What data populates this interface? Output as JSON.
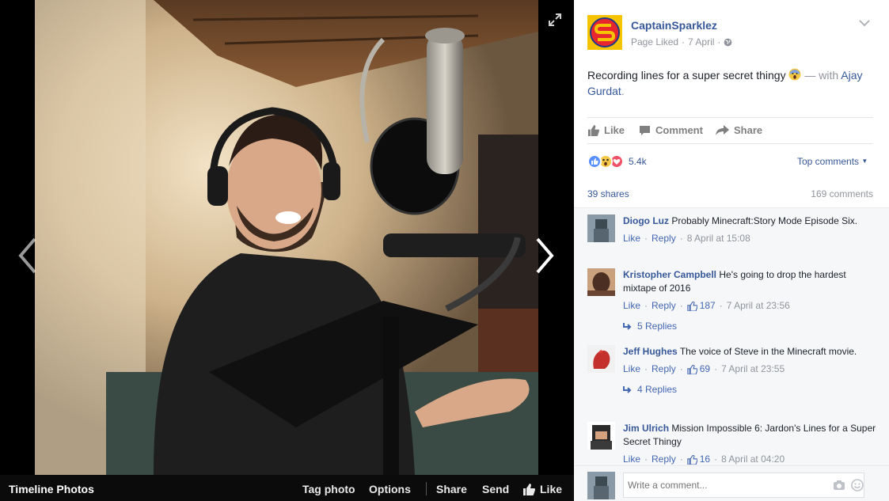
{
  "photo_viewer": {
    "album_title": "Timeline Photos",
    "actions": {
      "tag": "Tag photo",
      "options": "Options",
      "share": "Share",
      "send": "Send",
      "like": "Like"
    }
  },
  "post": {
    "page_name": "CaptainSparklez",
    "status": "Page Liked",
    "date": "7 April",
    "separator": "·",
    "text": "Recording lines for a super secret thingy",
    "with_prefix": "— with",
    "tagged": "Ajay Gurdat",
    "tagged_suffix": ".",
    "actions": {
      "like": "Like",
      "comment": "Comment",
      "share": "Share"
    },
    "reaction_count": "5.4k",
    "sort_label": "Top comments",
    "shares": "39 shares",
    "comments_count": "169 comments"
  },
  "comments": [
    {
      "name": "Diogo Luz",
      "text": "Probably Minecraft:Story Mode Episode Six.",
      "like": "Like",
      "reply": "Reply",
      "likes": "",
      "time": "8 April at 15:08",
      "replies": ""
    },
    {
      "name": "Kristopher Campbell",
      "text": "He's going to drop the hardest mixtape of 2016",
      "like": "Like",
      "reply": "Reply",
      "likes": "187",
      "time": "7 April at 23:56",
      "replies": "5 Replies"
    },
    {
      "name": "Jeff Hughes",
      "text": "The voice of Steve in the Minecraft movie.",
      "like": "Like",
      "reply": "Reply",
      "likes": "69",
      "time": "7 April at 23:55",
      "replies": "4 Replies"
    },
    {
      "name": "Jim Ulrich",
      "text": "Mission Impossible 6: Jardon's Lines for a Super Secret Thingy",
      "like": "Like",
      "reply": "Reply",
      "likes": "16",
      "time": "8 April at 04:20",
      "replies": ""
    }
  ],
  "composer": {
    "placeholder": "Write a comment..."
  },
  "colors": {
    "link": "#365899",
    "muted": "#90949c",
    "brand_red": "#e8262d",
    "brand_yellow": "#f5c400"
  },
  "icons": [
    "expand-icon",
    "chevron-left-icon",
    "chevron-right-icon",
    "thumbs-up-icon",
    "comment-icon",
    "share-icon",
    "globe-icon",
    "chevron-down-icon",
    "camera-icon",
    "emoji-icon",
    "reply-arrow-icon",
    "like-reaction-icon",
    "wow-reaction-icon",
    "love-reaction-icon"
  ]
}
